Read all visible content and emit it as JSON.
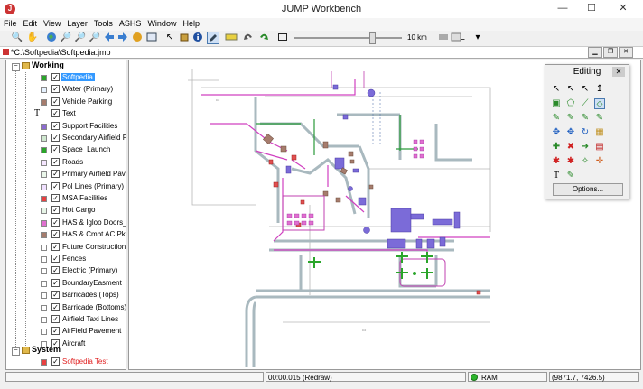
{
  "window": {
    "title": "JUMP Workbench",
    "minimize": "—",
    "maximize": "☐",
    "close": "✕"
  },
  "menu": [
    "File",
    "Edit",
    "View",
    "Layer",
    "Tools",
    "ASHS",
    "Window",
    "Help"
  ],
  "toolbar": {
    "icons": [
      "zoom-icon",
      "pan-icon",
      "globe-icon",
      "zoom-in-icon",
      "zoom-out-icon",
      "zoom-extent-icon",
      "back-icon",
      "forward-icon",
      "zoom-layer-icon",
      "zoom-selection-icon",
      "pointer-icon",
      "box-icon",
      "info-icon",
      "edit-toggle-icon",
      "measure-icon",
      "undo-icon",
      "redo-icon",
      "frame-icon"
    ],
    "scale_label": "10 km",
    "scale_level": 0.7,
    "dropdown_value": "L"
  },
  "document": {
    "tab_title": "*C:\\Softpedia\\Softpedia.jmp"
  },
  "layers": {
    "working_label": "Working",
    "system_label": "System",
    "working": [
      {
        "label": "Softpedia",
        "color": "#2aa52a",
        "checked": true,
        "selected": true
      },
      {
        "label": "Water (Primary)",
        "color": "#e6f2ff",
        "checked": true
      },
      {
        "label": "Vehicle Parking",
        "color": "#a67c6d",
        "checked": true
      },
      {
        "label": "Text",
        "color": "",
        "checked": true,
        "text_icon": "T"
      },
      {
        "label": "Support Facilities",
        "color": "#8c6bd0",
        "checked": true
      },
      {
        "label": "Secondary Airfield Pav",
        "color": "#cfe8cf",
        "checked": true
      },
      {
        "label": "Space_Launch",
        "color": "#2aa52a",
        "checked": true
      },
      {
        "label": "Roads",
        "color": "#f5e6ff",
        "checked": true
      },
      {
        "label": "Primary Airfield Pavem",
        "color": "#eaf7ea",
        "checked": true
      },
      {
        "label": "Pol Lines (Primary)",
        "color": "#f0e0ff",
        "checked": true
      },
      {
        "label": "MSA Facilities",
        "color": "#e84040",
        "checked": true
      },
      {
        "label": "Hot Cargo",
        "color": "#e7f5e7",
        "checked": true
      },
      {
        "label": "HAS & Igloo Doors_Ver",
        "color": "#e070d0",
        "checked": true
      },
      {
        "label": "HAS & Cmbt AC Pkng",
        "color": "#a67c6d",
        "checked": true
      },
      {
        "label": "Future Construction",
        "color": "#ffffff",
        "checked": true
      },
      {
        "label": "Fences",
        "color": "#ffffff",
        "checked": true
      },
      {
        "label": "Electric (Primary)",
        "color": "#ffffff",
        "checked": true
      },
      {
        "label": "BoundaryEasment",
        "color": "#ffffff",
        "checked": true
      },
      {
        "label": "Barricades (Tops)",
        "color": "#ffffff",
        "checked": true
      },
      {
        "label": "Barricade (Bottoms)",
        "color": "#ffffff",
        "checked": true
      },
      {
        "label": "Airfield Taxi Lines",
        "color": "#ffffff",
        "checked": true
      },
      {
        "label": "AirField Pavement",
        "color": "#ffffff",
        "checked": true
      },
      {
        "label": "Aircraft",
        "color": "#ffffff",
        "checked": true
      }
    ],
    "system": [
      {
        "label": "Softpedia Test",
        "color": "#e84040",
        "checked": true,
        "red_text": true
      }
    ]
  },
  "editing": {
    "title": "Editing",
    "close": "✕",
    "icons": [
      "select-icon",
      "select-part-icon",
      "select-line-icon",
      "snap-icon",
      "draw-rect-icon",
      "draw-polygon-icon",
      "draw-line-icon",
      "draw-point-icon",
      "move-vertex-icon",
      "insert-vertex-icon",
      "delete-vertex-icon",
      "drag-vertex-icon",
      "move-feature-icon",
      "rotate-icon",
      "cut-icon",
      "merge-icon",
      "split-icon",
      "erase-icon",
      "arrow-icon",
      "snap-target-icon",
      "extend-icon",
      "pin-icon",
      "join-icon",
      "stretch-icon",
      "text-icon",
      "paint-icon"
    ],
    "options_label": "Options..."
  },
  "status": {
    "time": "00:00.015 (Redraw)",
    "ram_label": "RAM",
    "coords": "(9871.7, 7426.5)"
  }
}
